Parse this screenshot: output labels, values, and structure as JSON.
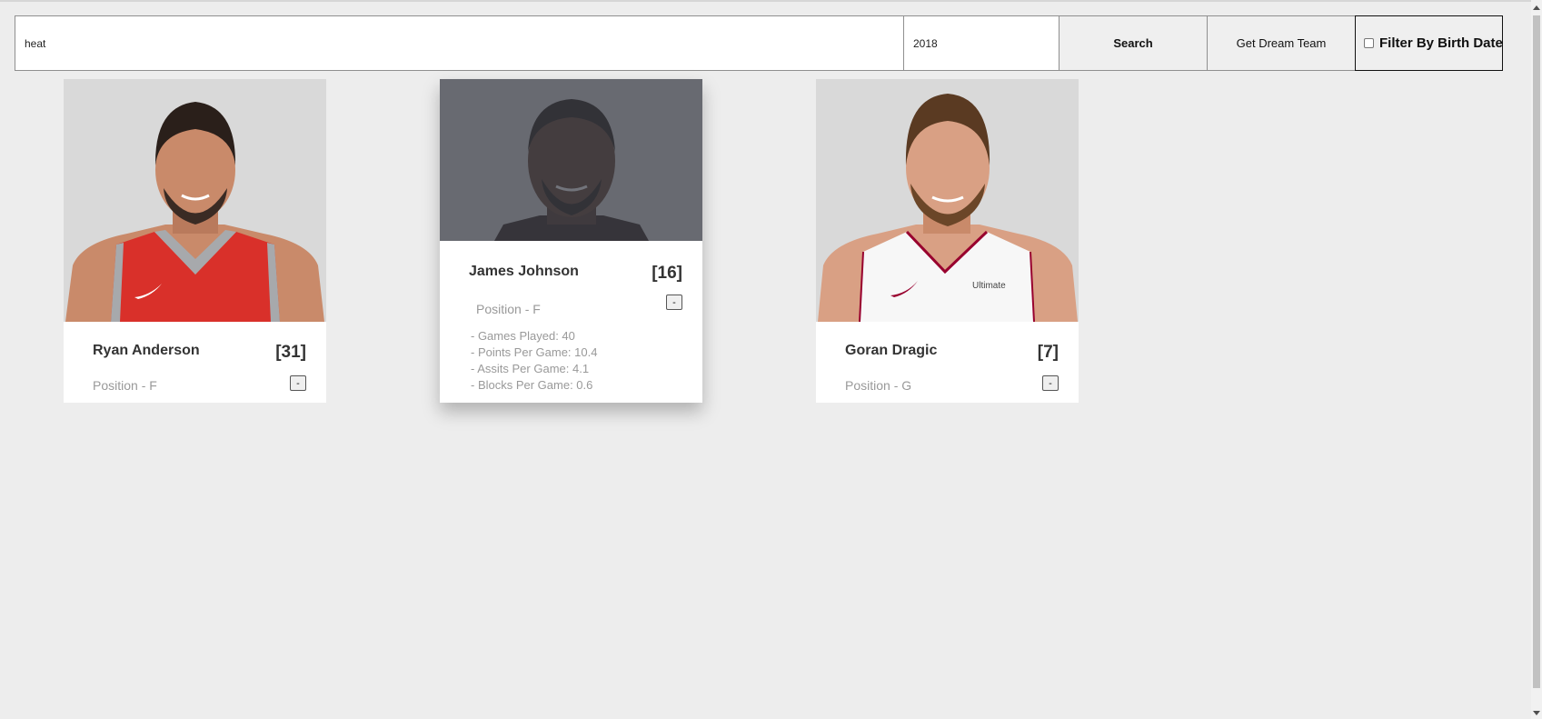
{
  "search": {
    "team_value": "heat",
    "year_value": "2018",
    "search_label": "Search",
    "dream_team_label": "Get Dream Team",
    "filter_label": "Filter By Birth Date",
    "filter_checked": false
  },
  "players": [
    {
      "name": "Ryan Anderson",
      "number": "[31]",
      "position": "Position - F",
      "toggle": "-",
      "jersey_color": "#d9302a"
    },
    {
      "name": "James Johnson",
      "number": "[16]",
      "position": "Position - F",
      "toggle": "-",
      "stats": [
        "- Games Played: 40",
        "- Points Per Game: 10.4",
        "- Assits Per Game: 4.1",
        "- Blocks Per Game: 0.6"
      ]
    },
    {
      "name": "Goran Dragic",
      "number": "[7]",
      "position": "Position - G",
      "toggle": "-",
      "jersey_color": "#f7f7f7"
    }
  ]
}
